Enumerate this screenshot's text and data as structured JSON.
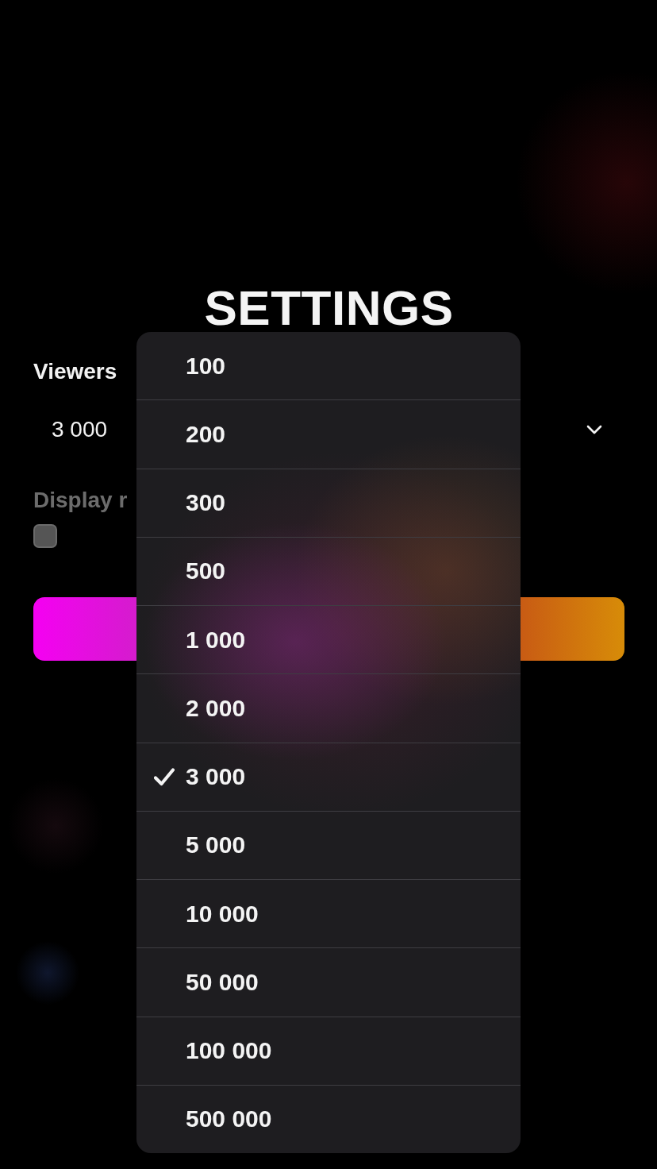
{
  "title": "SETTINGS",
  "viewers": {
    "label": "Viewers",
    "value": "3 000",
    "expanded": true
  },
  "display_option": {
    "label": "Display r",
    "checked": false,
    "disabled": true
  },
  "menu": {
    "options": [
      {
        "label": "100",
        "selected": false
      },
      {
        "label": "200",
        "selected": false
      },
      {
        "label": "300",
        "selected": false
      },
      {
        "label": "500",
        "selected": false
      },
      {
        "label": "1 000",
        "selected": false
      },
      {
        "label": "2 000",
        "selected": false
      },
      {
        "label": "3 000",
        "selected": true
      },
      {
        "label": "5 000",
        "selected": false
      },
      {
        "label": "10 000",
        "selected": false
      },
      {
        "label": "50 000",
        "selected": false
      },
      {
        "label": "100 000",
        "selected": false
      },
      {
        "label": "500 000",
        "selected": false
      }
    ]
  }
}
